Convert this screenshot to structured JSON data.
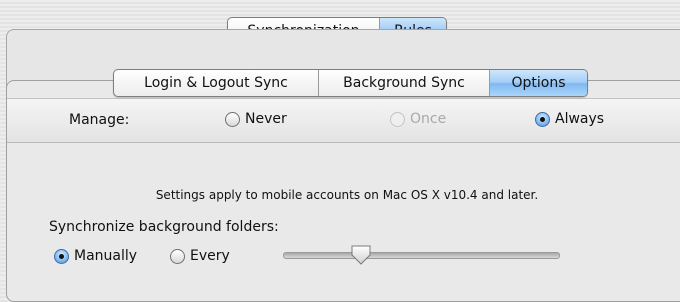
{
  "top_tabs": [
    {
      "label": "Synchronization",
      "selected": false
    },
    {
      "label": "Rules",
      "selected": true
    }
  ],
  "sub_tabs": [
    {
      "label": "Login & Logout Sync",
      "selected": false
    },
    {
      "label": "Background Sync",
      "selected": false
    },
    {
      "label": "Options",
      "selected": true
    }
  ],
  "manage": {
    "label": "Manage:",
    "options": [
      {
        "label": "Never",
        "selected": false,
        "enabled": true
      },
      {
        "label": "Once",
        "selected": false,
        "enabled": false
      },
      {
        "label": "Always",
        "selected": true,
        "enabled": true
      }
    ]
  },
  "note": "Settings apply to mobile accounts on Mac OS X v10.4 and later.",
  "background_folders": {
    "label": "Synchronize background folders:",
    "options": [
      {
        "label": "Manually",
        "selected": true
      },
      {
        "label": "Every",
        "selected": false
      }
    ]
  },
  "colors": {
    "selected_segment": "#8fc3f3",
    "accent_blue": "#4f8fd5"
  }
}
